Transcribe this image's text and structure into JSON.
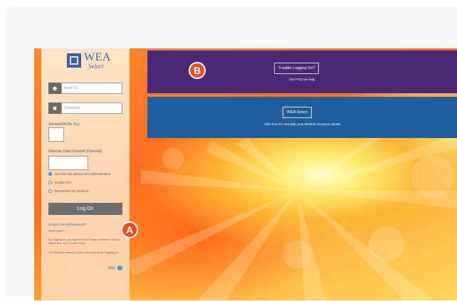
{
  "logo": {
    "name": "WEA",
    "tagline": "Select"
  },
  "login": {
    "email_placeholder": "Email ID",
    "password_placeholder": "Password",
    "security_label": "SecurityID/CAL Key",
    "effective_label": "Effective Date Override (Optional)",
    "option_remember_device": "Use this site without 2FA authentication",
    "option_2fa": "Enable 2FA",
    "option_remember_me": "Remember my Email ID",
    "login_button": "Log On",
    "link_forgot": "Forgot User ID/Password?",
    "link_new": "New User?",
    "terms_note": "By logging on, you agree to the Terms of Service, Privacy Statement, and Cookie Policy.",
    "contact_note": "Call Member services if you have any issues logging on.",
    "help_label": "Help"
  },
  "banners": {
    "purple": {
      "button": "Trouble Logging On?",
      "text": "Our FAQ can help"
    },
    "blue": {
      "button": "WEA Select",
      "text": "Click here for new plan year Medical insurance details"
    }
  },
  "callouts": {
    "a": "A",
    "b": "B"
  },
  "colors": {
    "purple_banner": "#4a2a73",
    "blue_banner": "#1f5d9b",
    "callout": "#ef4d23",
    "login_button": "#6e6e6e"
  }
}
